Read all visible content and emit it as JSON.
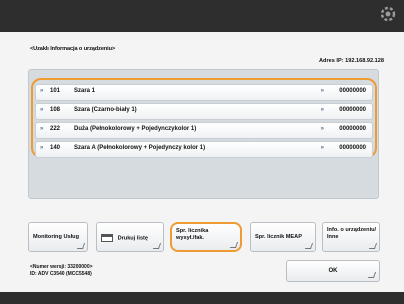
{
  "header": {
    "icon": "gear-icon"
  },
  "screen": {
    "title": "<Uzaklı Informacja o urządzeniu>",
    "ip_address": "Adres IP: 192.168.92.128"
  },
  "list": {
    "rows": [
      {
        "number": "101",
        "name": "Szara 1",
        "value": "00000000"
      },
      {
        "number": "108",
        "name": "Szara (Czarno-biały 1)",
        "value": "00000000"
      },
      {
        "number": "222",
        "name": "Duża (Pełnokolorowy + Pojedynczykolor 1)",
        "value": "00000000"
      },
      {
        "number": "140",
        "name": "Szara A (Pełnokolorowy + Pojedynczy kolor 1)",
        "value": "00000000"
      }
    ]
  },
  "buttons": {
    "monitoring": "Monitoring Usług",
    "print_list": "Drukuj listę",
    "check_counter": "Spr. licznika wysył./fak.",
    "check_counter_mp": "Spr. licznik MEAP",
    "info": "Info. o urządzeniu/ Inne"
  },
  "footer": {
    "firmware_line1": "<Numer wersji: 33200000>",
    "firmware_line2": "ID: ADV C3540 (MCC5548)",
    "ok_label": "OK"
  },
  "colors": {
    "highlight": "#ee9b33"
  }
}
